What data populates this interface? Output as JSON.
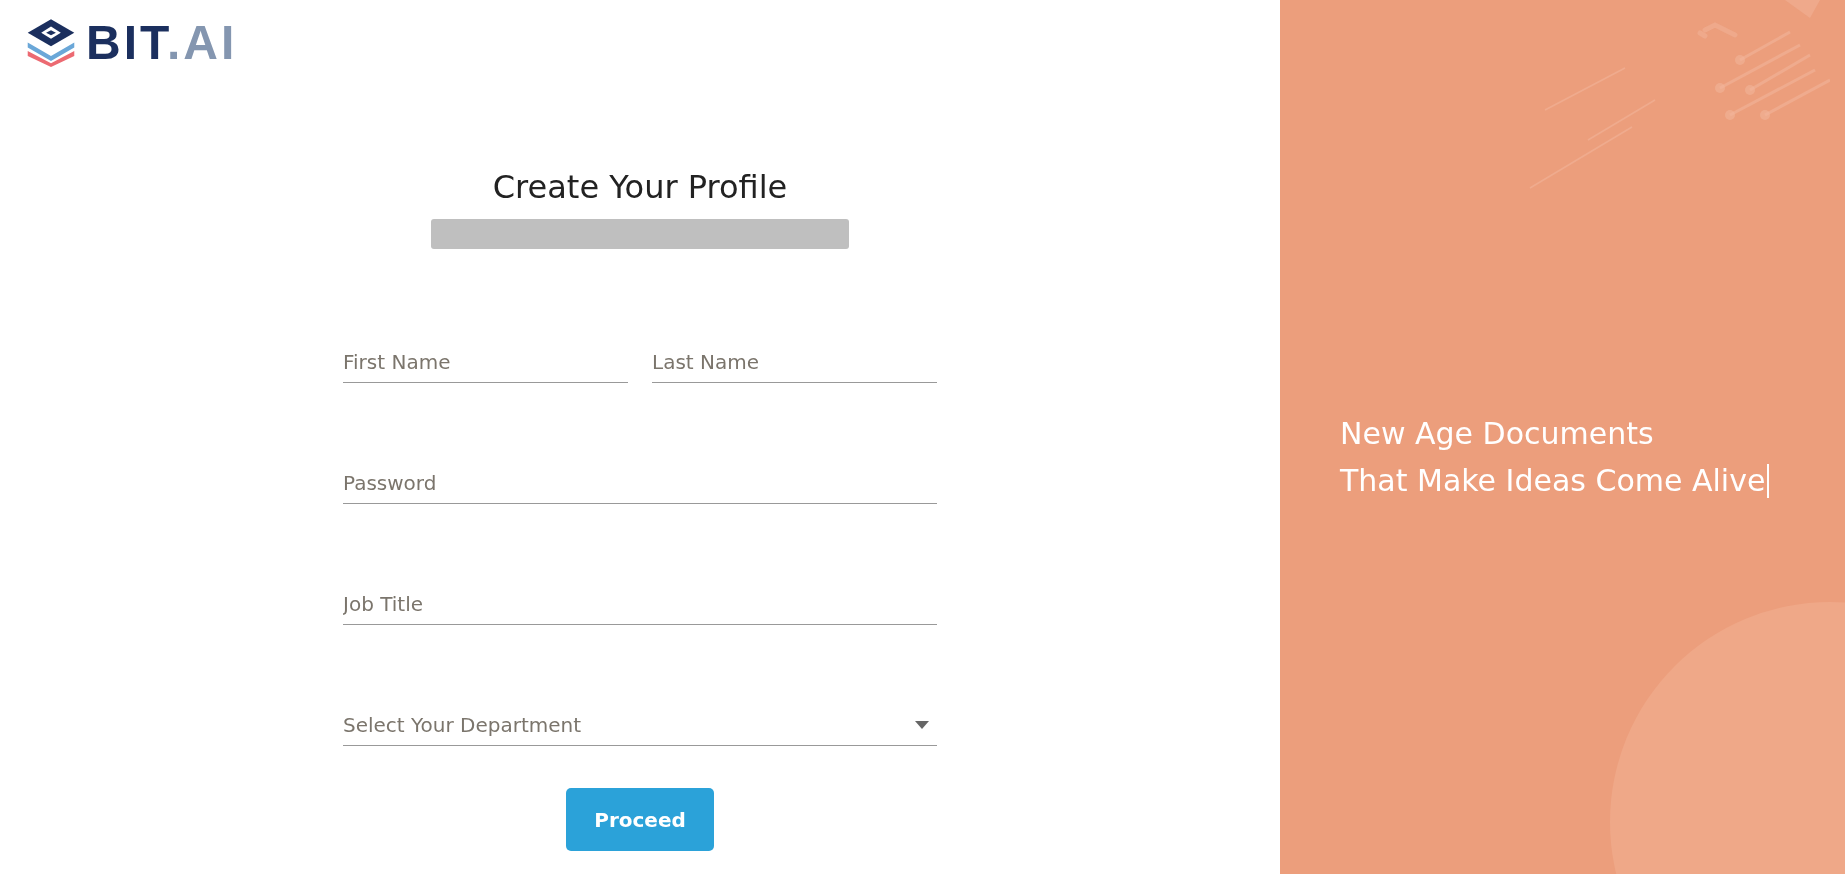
{
  "logo": {
    "brand": "BIT",
    "suffix": ".AI"
  },
  "form": {
    "title": "Create Your Profile",
    "fields": [
      {
        "kind": "text",
        "placeholder": "First Name"
      },
      {
        "kind": "text",
        "placeholder": "Last Name"
      },
      {
        "kind": "password",
        "placeholder": "Password"
      },
      {
        "kind": "text",
        "placeholder": "Job Title"
      },
      {
        "kind": "select",
        "placeholder": "Select Your Department"
      }
    ],
    "submit": "Proceed"
  },
  "promo": {
    "lines": [
      "New Age Documents",
      "That Make Ideas Come Alive"
    ]
  }
}
